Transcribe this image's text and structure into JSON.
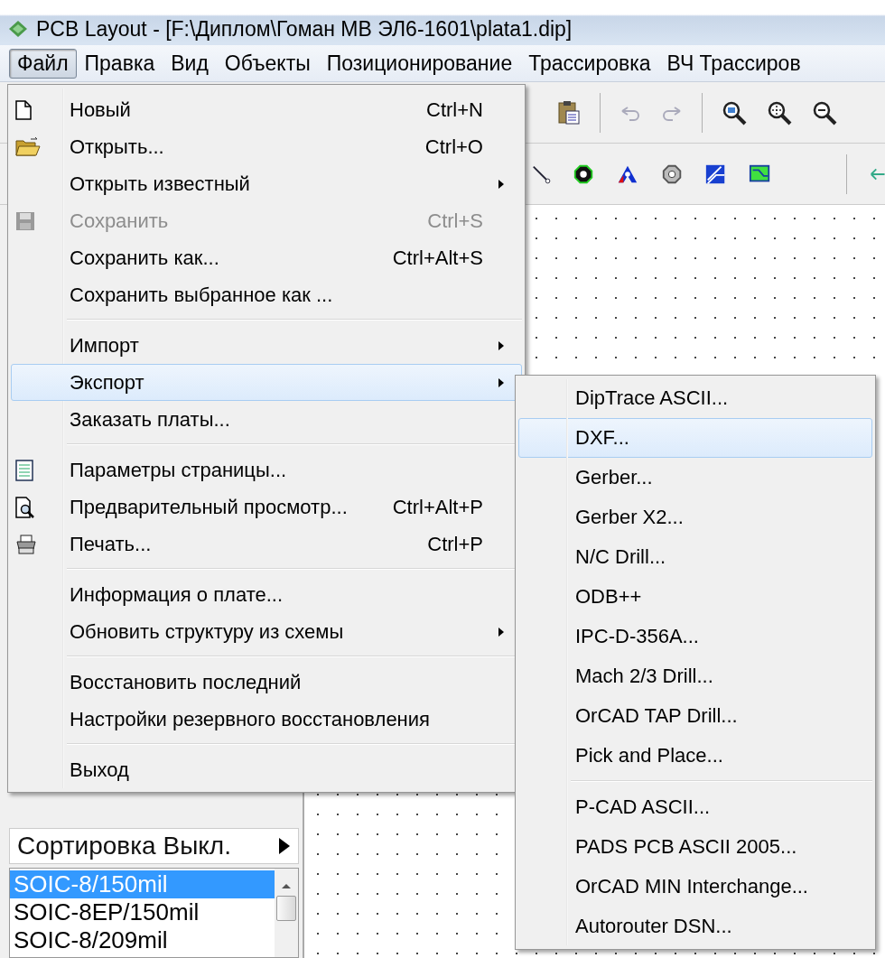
{
  "window": {
    "title": "PCB Layout - [F:\\Диплом\\Гоман МВ ЭЛ6-1601\\plata1.dip]"
  },
  "menubar": [
    {
      "label": "Файл",
      "selected": true
    },
    {
      "label": "Правка",
      "selected": false
    },
    {
      "label": "Вид",
      "selected": false
    },
    {
      "label": "Объекты",
      "selected": false
    },
    {
      "label": "Позиционирование",
      "selected": false
    },
    {
      "label": "Трассировка",
      "selected": false
    },
    {
      "label": "ВЧ Трассиров",
      "selected": false
    }
  ],
  "file_menu": {
    "items": [
      {
        "kind": "item",
        "label": "Новый",
        "shortcut": "Ctrl+N",
        "submenu": false,
        "disabled": false,
        "selected": false
      },
      {
        "kind": "item",
        "label": "Открыть...",
        "shortcut": "Ctrl+O",
        "submenu": false,
        "disabled": false,
        "selected": false
      },
      {
        "kind": "item",
        "label": "Открыть известный",
        "submenu": true,
        "disabled": false,
        "selected": false
      },
      {
        "kind": "item",
        "label": "Сохранить",
        "shortcut": "Ctrl+S",
        "submenu": false,
        "disabled": true,
        "selected": false
      },
      {
        "kind": "item",
        "label": "Сохранить как...",
        "shortcut": "Ctrl+Alt+S",
        "submenu": false,
        "disabled": false,
        "selected": false
      },
      {
        "kind": "item",
        "label": "Сохранить выбранное как ...",
        "submenu": false,
        "disabled": false,
        "selected": false
      },
      {
        "kind": "separator"
      },
      {
        "kind": "item",
        "label": "Импорт",
        "submenu": true,
        "disabled": false,
        "selected": false
      },
      {
        "kind": "item",
        "label": "Экспорт",
        "submenu": true,
        "disabled": false,
        "selected": true
      },
      {
        "kind": "item",
        "label": "Заказать платы...",
        "submenu": false,
        "disabled": false,
        "selected": false
      },
      {
        "kind": "separator"
      },
      {
        "kind": "item",
        "label": "Параметры страницы...",
        "submenu": false,
        "disabled": false,
        "selected": false
      },
      {
        "kind": "item",
        "label": "Предварительный просмотр...",
        "shortcut": "Ctrl+Alt+P",
        "submenu": false,
        "disabled": false,
        "selected": false
      },
      {
        "kind": "item",
        "label": "Печать...",
        "shortcut": "Ctrl+P",
        "submenu": false,
        "disabled": false,
        "selected": false
      },
      {
        "kind": "separator"
      },
      {
        "kind": "item",
        "label": "Информация о плате...",
        "submenu": false,
        "disabled": false,
        "selected": false
      },
      {
        "kind": "item",
        "label": "Обновить структуру из схемы",
        "submenu": true,
        "disabled": false,
        "selected": false
      },
      {
        "kind": "separator"
      },
      {
        "kind": "item",
        "label": "Восстановить последний",
        "submenu": false,
        "disabled": false,
        "selected": false
      },
      {
        "kind": "item",
        "label": "Настройки резервного восстановления",
        "submenu": false,
        "disabled": false,
        "selected": false
      },
      {
        "kind": "separator"
      },
      {
        "kind": "item",
        "label": "Выход",
        "submenu": false,
        "disabled": false,
        "selected": false
      }
    ]
  },
  "export_submenu": {
    "items": [
      {
        "kind": "item",
        "label": "DipTrace ASCII...",
        "selected": false
      },
      {
        "kind": "item",
        "label": "DXF...",
        "selected": true
      },
      {
        "kind": "item",
        "label": "Gerber...",
        "selected": false
      },
      {
        "kind": "item",
        "label": "Gerber X2...",
        "selected": false
      },
      {
        "kind": "item",
        "label": "N/C Drill...",
        "selected": false
      },
      {
        "kind": "item",
        "label": "ODB++",
        "selected": false
      },
      {
        "kind": "item",
        "label": "IPC-D-356A...",
        "selected": false
      },
      {
        "kind": "item",
        "label": "Mach 2/3 Drill...",
        "selected": false
      },
      {
        "kind": "item",
        "label": "OrCAD TAP Drill...",
        "selected": false
      },
      {
        "kind": "item",
        "label": "Pick and Place...",
        "selected": false
      },
      {
        "kind": "separator"
      },
      {
        "kind": "item",
        "label": "P-CAD ASCII...",
        "selected": false
      },
      {
        "kind": "item",
        "label": "PADS PCB ASCII 2005...",
        "selected": false
      },
      {
        "kind": "item",
        "label": "OrCAD MIN Interchange...",
        "selected": false
      },
      {
        "kind": "item",
        "label": "Autorouter DSN...",
        "selected": false
      }
    ]
  },
  "left_panel": {
    "sort_button": {
      "label": "Сортировка Выкл."
    },
    "patterns": [
      {
        "label": "SOIC-8/150mil",
        "selected": true
      },
      {
        "label": "SOIC-8EP/150mil",
        "selected": false
      },
      {
        "label": "SOIC-8/209mil",
        "selected": false
      }
    ]
  }
}
